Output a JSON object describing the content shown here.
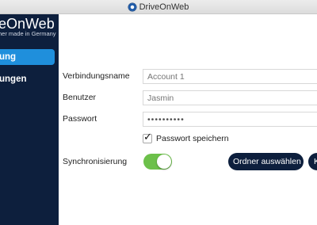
{
  "window": {
    "title": "DriveOnWeb",
    "app_icon": "driveonweb-app-icon"
  },
  "sidebar": {
    "logo_text": "eOnWeb",
    "tagline": "her made in Germany",
    "items": [
      {
        "label": "ung",
        "active": true
      },
      {
        "label": "ungen",
        "active": false
      }
    ]
  },
  "form": {
    "connection_name": {
      "label": "Verbindungsname",
      "placeholder": "Account 1"
    },
    "user": {
      "label": "Benutzer",
      "placeholder": "Jasmin"
    },
    "password": {
      "label": "Passwort",
      "value": "••••••••••"
    },
    "save_password": {
      "label": "Passwort speichern",
      "checked": true,
      "check_glyph": "✓"
    },
    "sync": {
      "label": "Synchronisierung",
      "enabled": true
    },
    "select_folder_label": "Ordner auswählen",
    "partial_button_label": "K"
  },
  "colors": {
    "sidebar_bg": "#0d1f3d",
    "active_item": "#1f8fdc",
    "toggle_on": "#6cc04a",
    "button_bg": "#0d1f3d"
  }
}
